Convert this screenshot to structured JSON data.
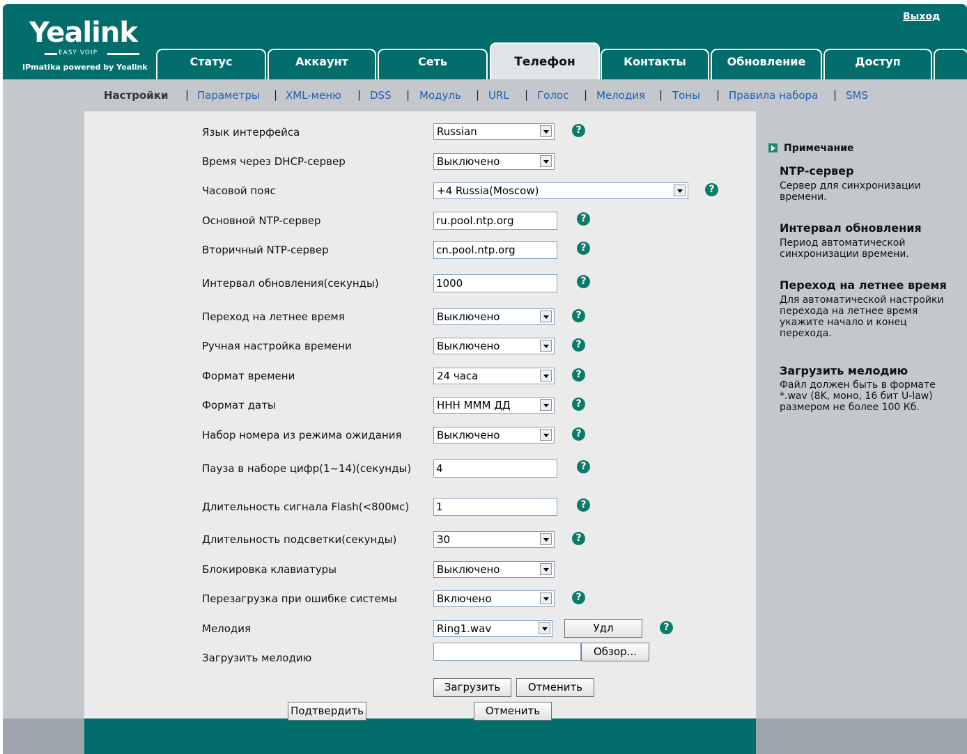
{
  "header": {
    "logo_text": "Yealink",
    "logo_sub": "EASY VOIP",
    "tagline": "IPmatika powered by Yealink",
    "logout": "Выход",
    "brand_color": "#036d6c"
  },
  "tabs": [
    {
      "label": "Статус"
    },
    {
      "label": "Аккаунт"
    },
    {
      "label": "Сеть"
    },
    {
      "label": "Телефон",
      "active": true
    },
    {
      "label": "Контакты"
    },
    {
      "label": "Обновление"
    },
    {
      "label": "Доступ"
    }
  ],
  "subnav": {
    "items": [
      "Настройки",
      "Параметры",
      "XML-меню",
      "DSS",
      "Модуль",
      "URL",
      "Голос",
      "Мелодия",
      "Тоны",
      "Правила набора",
      "SMS"
    ],
    "current": "Настройки",
    "separator": "|"
  },
  "form": {
    "language": {
      "label": "Язык интерфейса",
      "value": "Russian"
    },
    "dhcp_time": {
      "label": "Время через DHCP-сервер",
      "value": "Выключено"
    },
    "timezone": {
      "label": "Часовой пояс",
      "value": "+4 Russia(Moscow)"
    },
    "ntp_primary": {
      "label": "Основной NTP-сервер",
      "value": "ru.pool.ntp.org"
    },
    "ntp_secondary": {
      "label": "Вторичный NTP-сервер",
      "value": "cn.pool.ntp.org"
    },
    "update_interval": {
      "label": "Интервал обновления(секунды)",
      "value": "1000"
    },
    "dst": {
      "label": "Переход на летнее время",
      "value": "Выключено"
    },
    "manual_time": {
      "label": "Ручная настройка времени",
      "value": "Выключено"
    },
    "time_format": {
      "label": "Формат времени",
      "value": "24 часа"
    },
    "date_format": {
      "label": "Формат даты",
      "value": "ННН МММ ДД"
    },
    "idle_dial": {
      "label": "Набор номера из режима ожидания",
      "value": "Выключено"
    },
    "dial_pause": {
      "label": "Пауза в наборе цифр(1~14)(секунды)",
      "value": "4"
    },
    "flash_duration": {
      "label": "Длительность сигнала Flash(<800мс)",
      "value": "1"
    },
    "backlight": {
      "label": "Длительность подсветки(секунды)",
      "value": "30"
    },
    "keypad_lock": {
      "label": "Блокировка клавиатуры",
      "value": "Выключено"
    },
    "reboot_on_error": {
      "label": "Перезагрузка при ошибке системы",
      "value": "Включено"
    },
    "ringtone": {
      "label": "Мелодия",
      "value": "Ring1.wav",
      "delete_button": "Удл"
    },
    "upload_ringtone": {
      "label": "Загрузить мелодию",
      "file_value": "",
      "browse_button": "Обзор...",
      "upload_button": "Загрузить",
      "cancel_button": "Отменить"
    },
    "help_icon": "?"
  },
  "actions": {
    "confirm": "Подтвердить",
    "cancel": "Отменить"
  },
  "notes": {
    "heading": "Примечание",
    "items": [
      {
        "title": "NTP-сервер",
        "text": "Сервер для синхронизации времени."
      },
      {
        "title": "Интервал обновления",
        "text": "Период автоматической синхронизации времени."
      },
      {
        "title": "Переход на летнее время",
        "text": "Для автоматической настройки перехода на летнее время укажите начало и конец перехода."
      },
      {
        "title": "Загрузить мелодию",
        "text": "Файл должен быть в формате *.wav (8K, моно, 16 бит U-law) размером не более 100 Кб."
      }
    ]
  }
}
